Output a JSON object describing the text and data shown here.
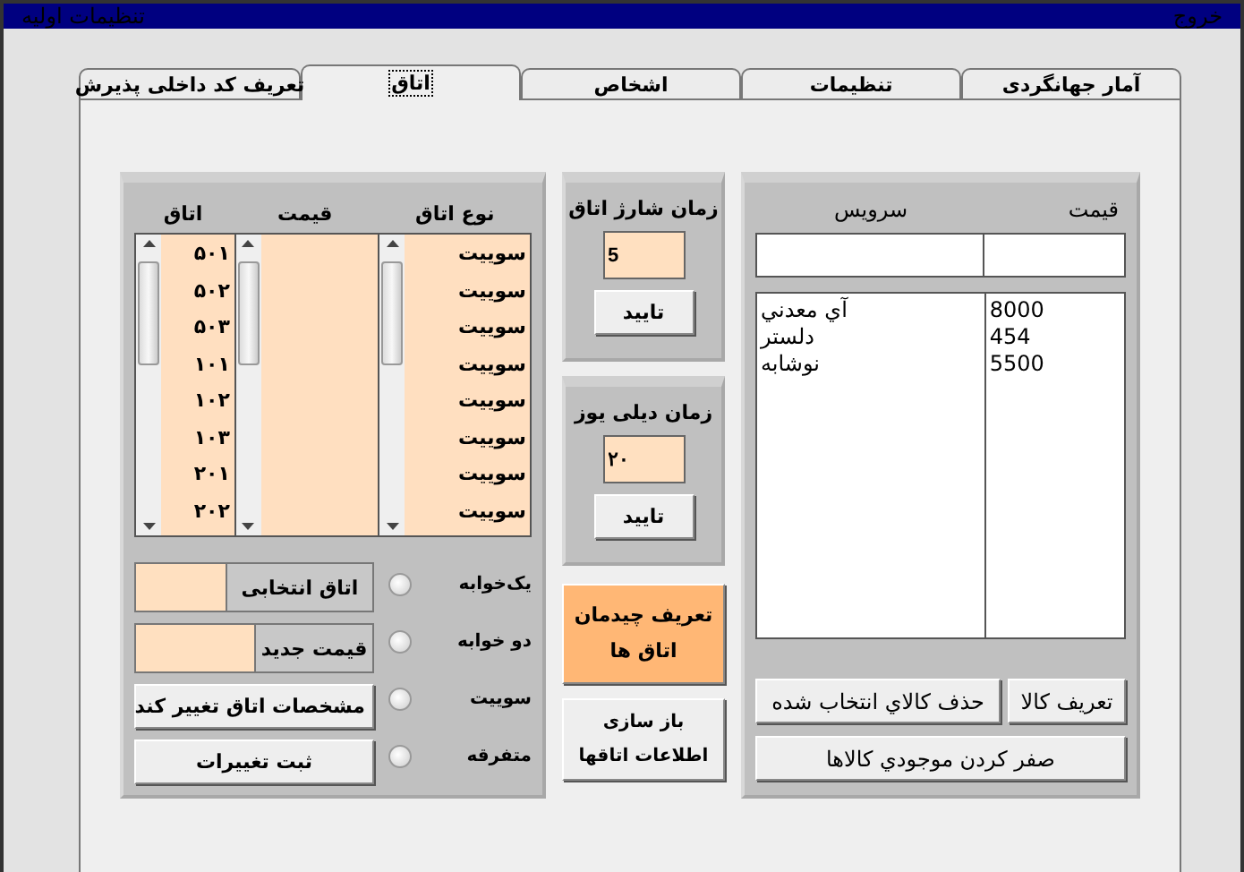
{
  "window": {
    "title": "تنظیمات اولیه",
    "exit_label": "خروج"
  },
  "tabs": [
    {
      "label": "آمار جهانگردی",
      "selected": false
    },
    {
      "label": "تنظیمات",
      "selected": false
    },
    {
      "label": "اشخاص",
      "selected": false
    },
    {
      "label": "اتاق",
      "selected": true
    },
    {
      "label": "تعریف کد داخلی پذیرش",
      "selected": false
    }
  ],
  "services": {
    "columns": [
      "قیمت",
      "سرویس"
    ],
    "rows": [
      {
        "name": "آي معدني",
        "price": "8000"
      },
      {
        "name": "دلستر",
        "price": "454"
      },
      {
        "name": "نوشابه",
        "price": "5500"
      }
    ],
    "buttons": [
      "تعریف کالا",
      "حذف کالاي انتخاب شده"
    ],
    "reset_button": "صفر کردن موجودي کالاها"
  },
  "charge_time": {
    "title": "زمان شارژ اتاق",
    "value": "5",
    "button": "تایید"
  },
  "day_use_time": {
    "title": "زمان دیلی یوز",
    "value": "۲۰",
    "button": "تایید"
  },
  "layout_button": "تعریف چیدمان اتاق ها",
  "rebuild_button": "باز سازی اطلاعات اتاقها",
  "rooms": {
    "columns": [
      "نوع اتاق",
      "قیمت",
      "اتاق"
    ],
    "room_types": [
      "سوییت",
      "سوییت",
      "سوییت",
      "سوییت",
      "سوییت",
      "سوییت",
      "سوییت",
      "سوییت"
    ],
    "room_numbers": [
      "۵۰۱",
      "۵۰۲",
      "۵۰۳",
      "۱۰۱",
      "۱۰۲",
      "۱۰۳",
      "۲۰۱",
      "۲۰۲"
    ]
  },
  "room_filters": [
    {
      "label": "یک‌خوابه",
      "selected": false
    },
    {
      "label": "دو خوابه",
      "selected": false
    },
    {
      "label": "سوییت",
      "selected": false
    },
    {
      "label": "متفرقه",
      "selected": false
    }
  ],
  "selected_room": {
    "label": "اتاق انتخابی"
  },
  "new_price": {
    "label": "قیمت جدید"
  },
  "room_buttons": [
    "مشخصات اتاق تغییر کند",
    "ثبت تغییرات"
  ]
}
